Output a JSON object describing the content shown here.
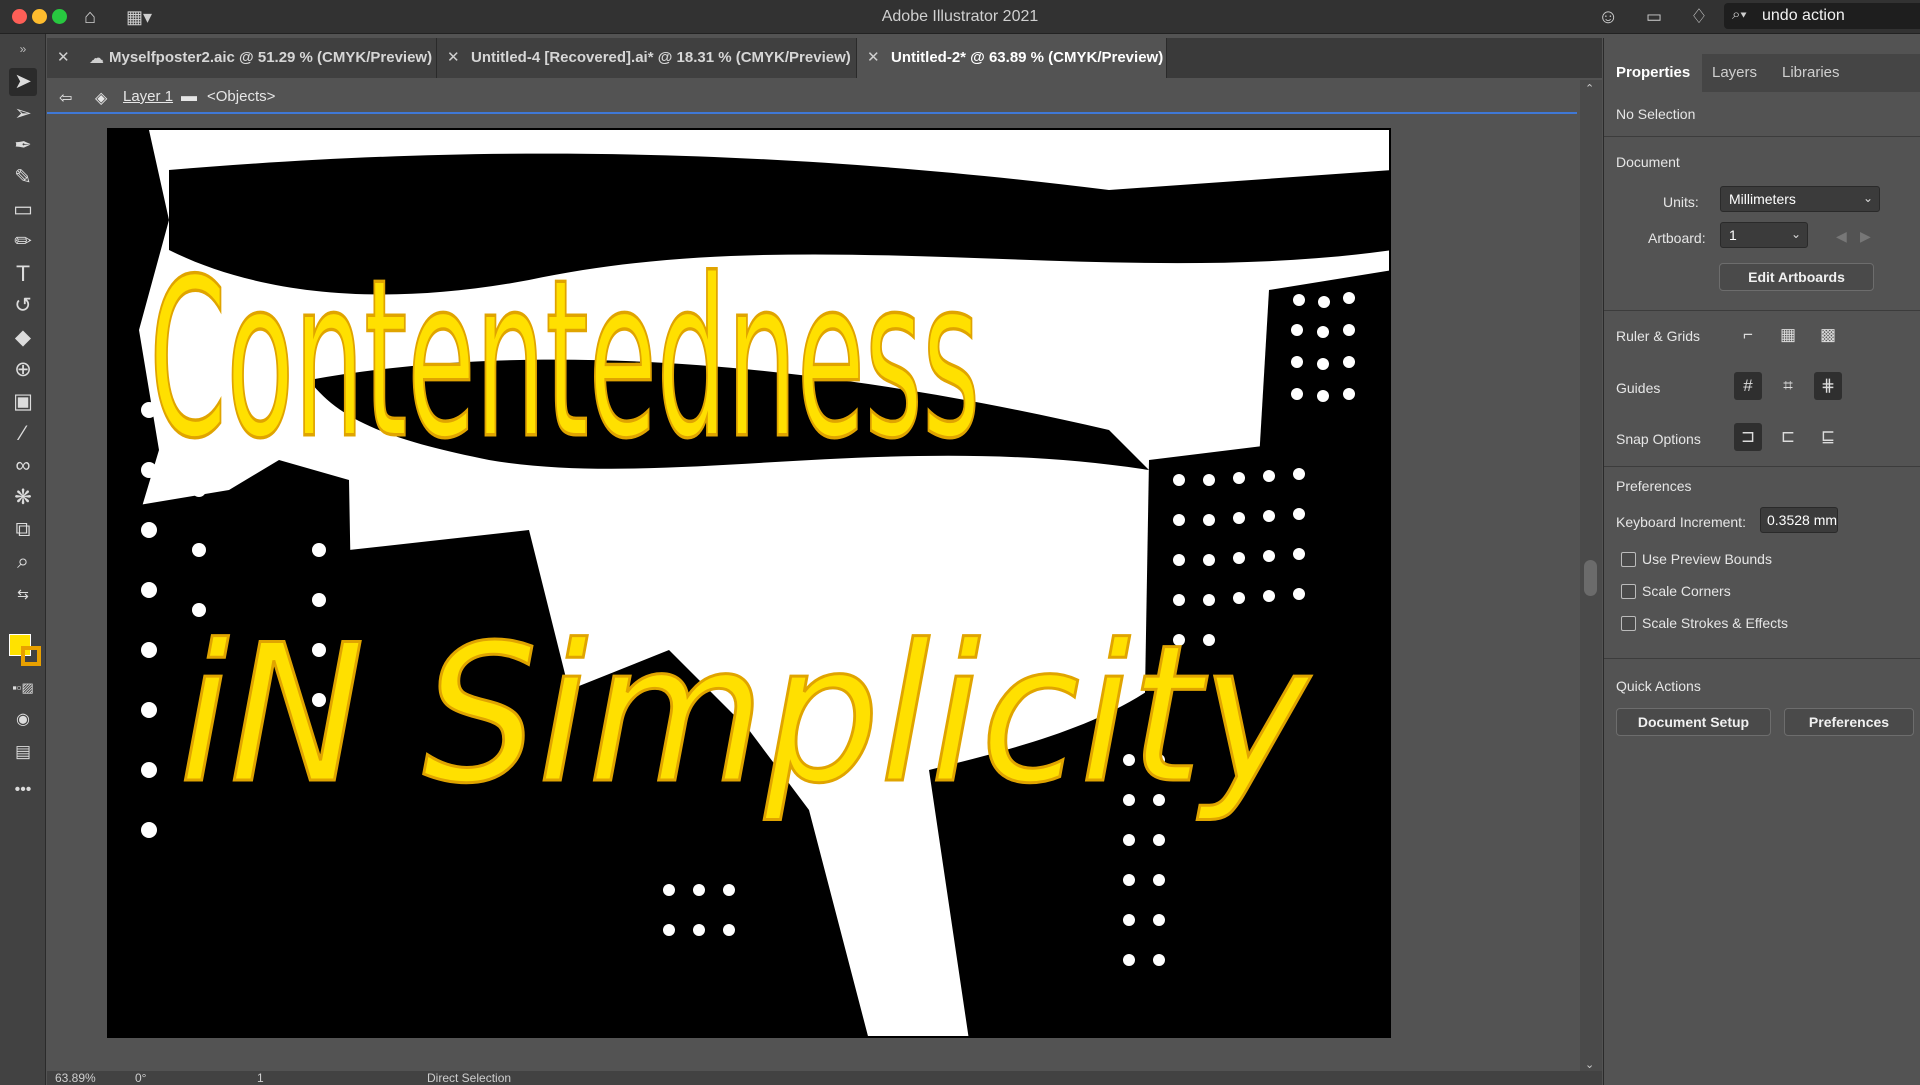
{
  "window": {
    "title": "Adobe Illustrator 2021",
    "search_value": "undo action"
  },
  "document_tabs": [
    {
      "label": "Myselfposter2.aic @ 51.29 % (CMYK/Preview)"
    },
    {
      "label": "Untitled-4 [Recovered].ai* @ 18.31 % (CMYK/Preview)"
    },
    {
      "label": "Untitled-2* @ 63.89 % (CMYK/Preview)"
    }
  ],
  "breadcrumb": {
    "layer": "Layer 1",
    "objects": "<Objects>"
  },
  "artwork": {
    "line1": "Contentedness",
    "line2": "iN Simplicity",
    "fill_color": "#ffe000",
    "stroke_color": "#e0a400"
  },
  "colors": {
    "fill_swatch": "#ffe200",
    "stroke_swatch": "#e8a000",
    "accent": "#3f78d6"
  },
  "properties_panel": {
    "tabs": [
      "Properties",
      "Layers",
      "Libraries"
    ],
    "no_selection": "No Selection",
    "document_heading": "Document",
    "units_label": "Units:",
    "units_value": "Millimeters",
    "artboard_label": "Artboard:",
    "artboard_value": "1",
    "edit_artboards": "Edit Artboards",
    "ruler_grids": "Ruler & Grids",
    "guides": "Guides",
    "snap_options": "Snap Options",
    "preferences_heading": "Preferences",
    "keyboard_increment_label": "Keyboard Increment:",
    "keyboard_increment_value": "0.3528 mm",
    "use_preview_bounds": "Use Preview Bounds",
    "scale_corners": "Scale Corners",
    "scale_strokes_effects": "Scale Strokes & Effects",
    "quick_actions": "Quick Actions",
    "document_setup": "Document Setup",
    "preferences_button": "Preferences"
  },
  "status": {
    "zoom": "63.89%",
    "rotation": "0°",
    "artboard": "1",
    "tool": "Direct Selection"
  }
}
